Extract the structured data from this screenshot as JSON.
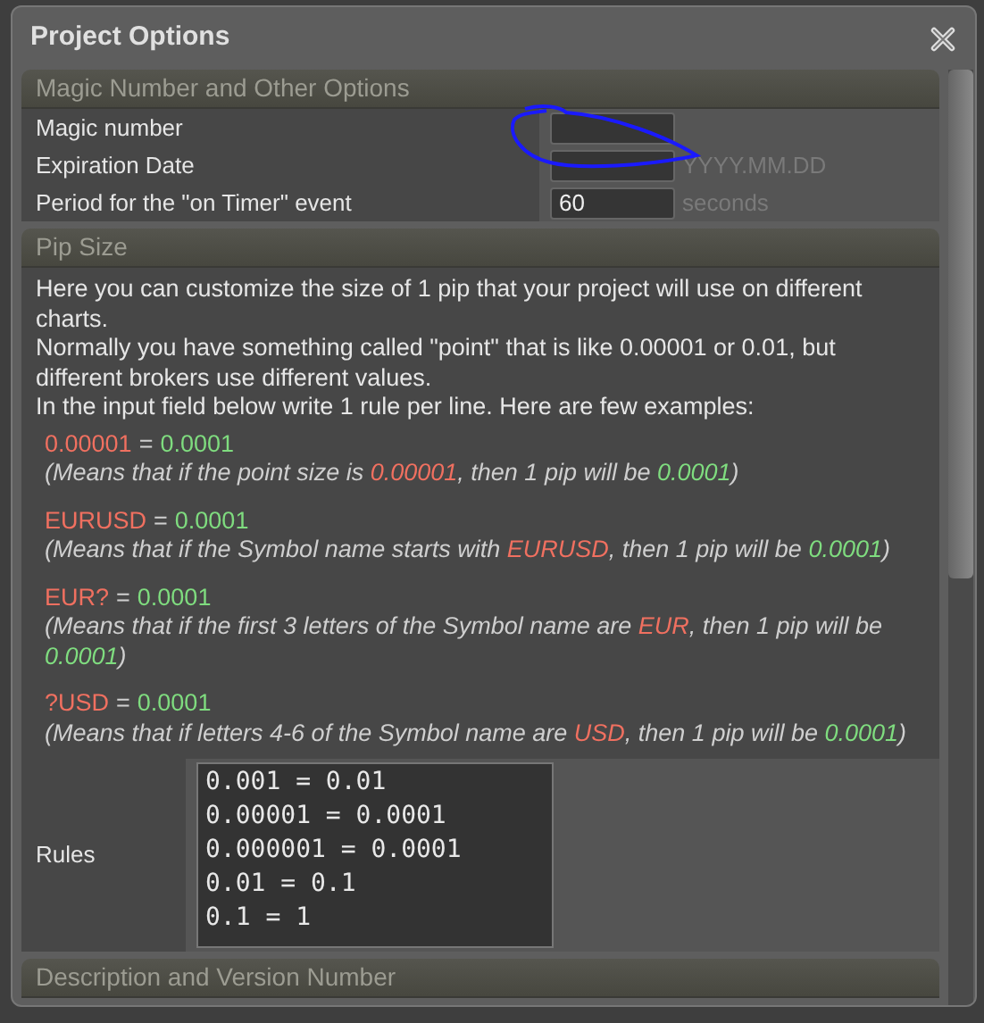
{
  "window": {
    "title": "Project Options"
  },
  "sections": [
    {
      "title": "Magic Number and Other Options",
      "kind": "options",
      "rows": [
        {
          "label": "Magic number",
          "value": "",
          "suffix": ""
        },
        {
          "label": "Expiration Date",
          "value": "",
          "suffix": "YYYY.MM.DD"
        },
        {
          "label": "Period for the \"on Timer\" event",
          "value": "60",
          "suffix": "seconds"
        }
      ]
    },
    {
      "title": "Pip Size",
      "kind": "pip",
      "intro": [
        "Here you can customize the size of 1 pip that your project will use on different charts.",
        "Normally you have something called \"point\" that is like 0.00001 or 0.01, but different brokers use different values.",
        "In the input field below write 1 rule per line. Here are few examples:"
      ],
      "examples": [
        {
          "pattern": "0.00001",
          "equals": "=",
          "value": "0.0001",
          "explanation": [
            {
              "kind": "plain",
              "text": "(Means that if the point size is "
            },
            {
              "kind": "pattern",
              "text": "0.00001"
            },
            {
              "kind": "plain",
              "text": ", then 1 pip will be "
            },
            {
              "kind": "value",
              "text": "0.0001"
            },
            {
              "kind": "plain",
              "text": ")"
            }
          ]
        },
        {
          "pattern": "EURUSD",
          "equals": "=",
          "value": "0.0001",
          "explanation": [
            {
              "kind": "plain",
              "text": "(Means that if the Symbol name starts with "
            },
            {
              "kind": "pattern",
              "text": "EURUSD"
            },
            {
              "kind": "plain",
              "text": ", then 1 pip will be "
            },
            {
              "kind": "value",
              "text": "0.0001"
            },
            {
              "kind": "plain",
              "text": ")"
            }
          ]
        },
        {
          "pattern": "EUR?",
          "equals": "=",
          "value": "0.0001",
          "explanation": [
            {
              "kind": "plain",
              "text": "(Means that if the first 3 letters of the Symbol name are "
            },
            {
              "kind": "pattern",
              "text": "EUR"
            },
            {
              "kind": "plain",
              "text": ", then 1 pip will be "
            },
            {
              "kind": "value",
              "text": "0.0001"
            },
            {
              "kind": "plain",
              "text": ")"
            }
          ]
        },
        {
          "pattern": "?USD",
          "equals": "=",
          "value": "0.0001",
          "explanation": [
            {
              "kind": "plain",
              "text": "(Means that if letters 4-6 of the Symbol name are "
            },
            {
              "kind": "pattern",
              "text": "USD"
            },
            {
              "kind": "plain",
              "text": ", then 1 pip will be "
            },
            {
              "kind": "value",
              "text": "0.0001"
            },
            {
              "kind": "plain",
              "text": ")"
            }
          ]
        }
      ],
      "rules_label": "Rules",
      "rules": "0.001 = 0.01\n0.00001 = 0.0001\n0.000001 = 0.0001\n0.01 = 0.1\n0.1 = 1"
    },
    {
      "title": "Description and Version Number",
      "kind": "collapsed"
    }
  ]
}
